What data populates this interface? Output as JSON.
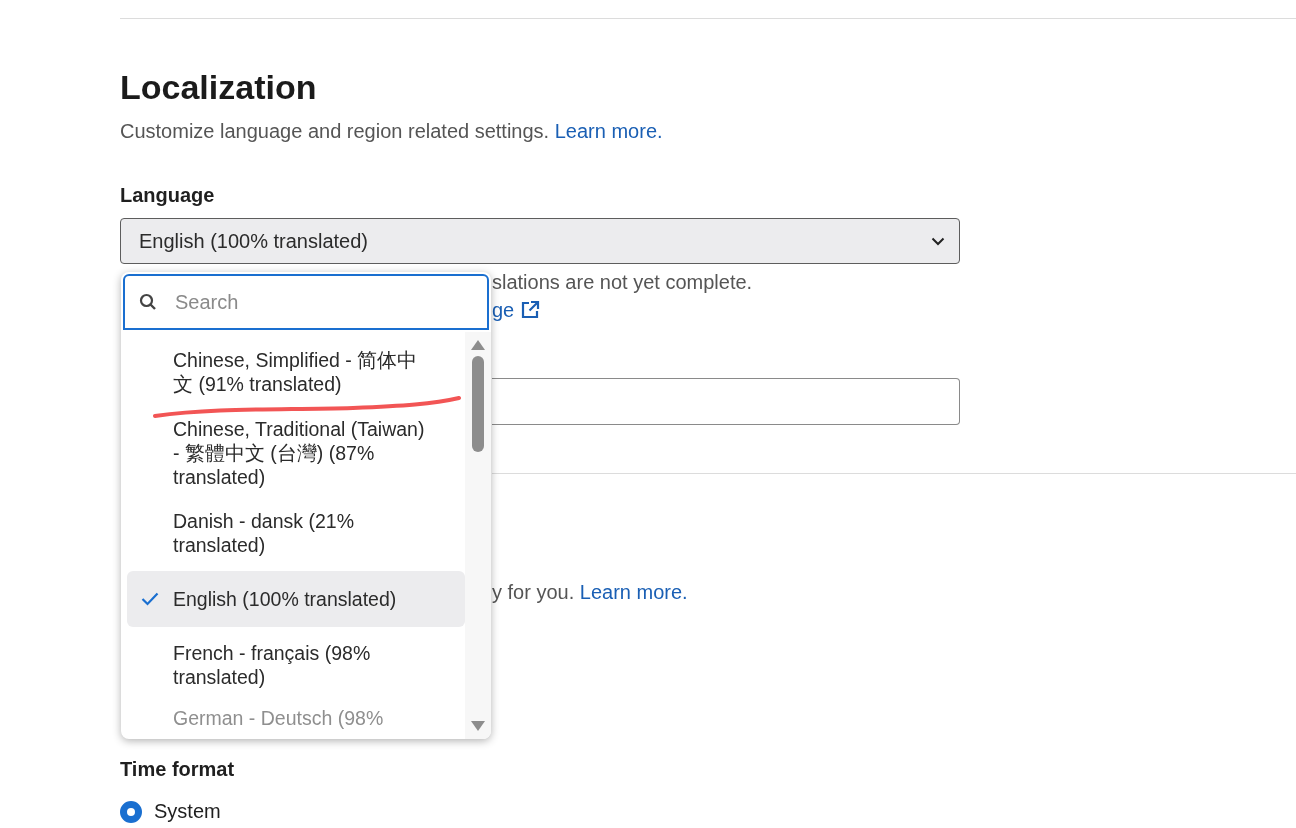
{
  "section": {
    "title": "Localization",
    "description": "Customize language and region related settings.",
    "learn_more": "Learn more."
  },
  "language": {
    "label": "Language",
    "value": "English (100% translated)",
    "hint_fragment": "slations are not yet complete.",
    "link_fragment": "ge",
    "open": true
  },
  "dropdown": {
    "search": {
      "placeholder": "Search"
    },
    "options": [
      {
        "label": "Chinese, Simplified - 简体中文 (91% translated)",
        "selected": false,
        "faded": false
      },
      {
        "label": "Chinese, Traditional (Taiwan) - 繁體中文 (台灣) (87% translated)",
        "selected": false,
        "faded": false
      },
      {
        "label": "Danish - dansk (21% translated)",
        "selected": false,
        "faded": false
      },
      {
        "label": "English (100% translated)",
        "selected": true,
        "faded": false
      },
      {
        "label": "French - français (98% translated)",
        "selected": false,
        "faded": false
      },
      {
        "label": "German - Deutsch (98%",
        "selected": false,
        "faded": true
      }
    ]
  },
  "next_section": {
    "text_fragment": "y for you.",
    "learn_more": "Learn more."
  },
  "time_format": {
    "label": "Time format",
    "options": [
      {
        "label": "System",
        "selected": true
      }
    ]
  }
}
